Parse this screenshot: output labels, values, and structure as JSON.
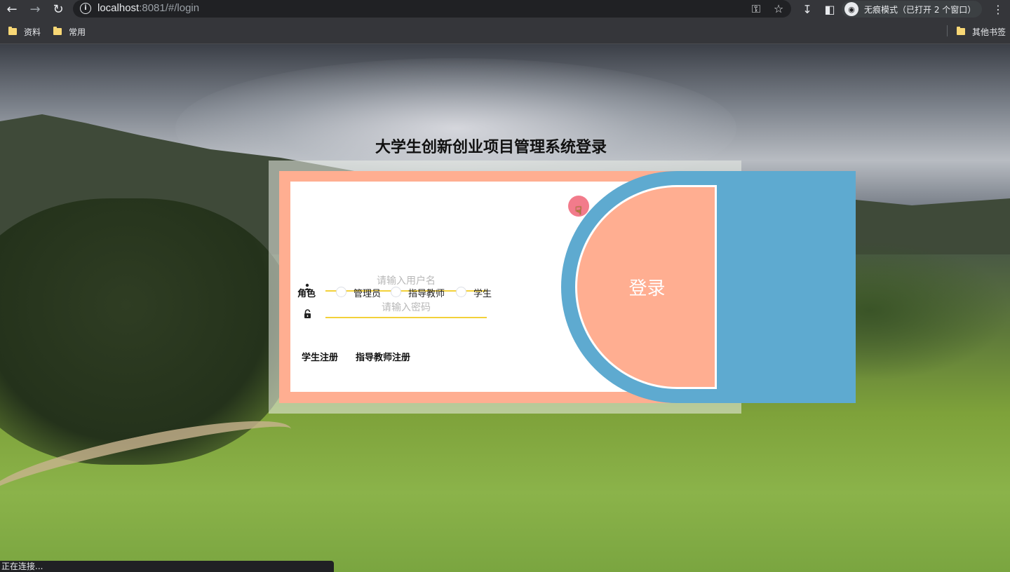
{
  "browser": {
    "url_host": "localhost",
    "url_rest": ":8081/#/login",
    "incognito_label": "无痕模式（已打开 2 个窗口）",
    "bookmarks": [
      {
        "label": "资料"
      },
      {
        "label": "常用"
      }
    ],
    "other_bookmarks": "其他书签",
    "status_text": "正在连接..."
  },
  "login": {
    "title": "大学生创新创业项目管理系统登录",
    "username_placeholder": "请输入用户名",
    "password_placeholder": "请输入密码",
    "role_label": "角色",
    "roles": [
      "管理员",
      "指导教师",
      "学生"
    ],
    "login_button": "登录",
    "student_register": "学生注册",
    "teacher_register": "指导教师注册"
  },
  "colors": {
    "accent_salmon": "#ffae91",
    "accent_blue": "#5eaad0",
    "input_underline": "#f3d13a"
  }
}
